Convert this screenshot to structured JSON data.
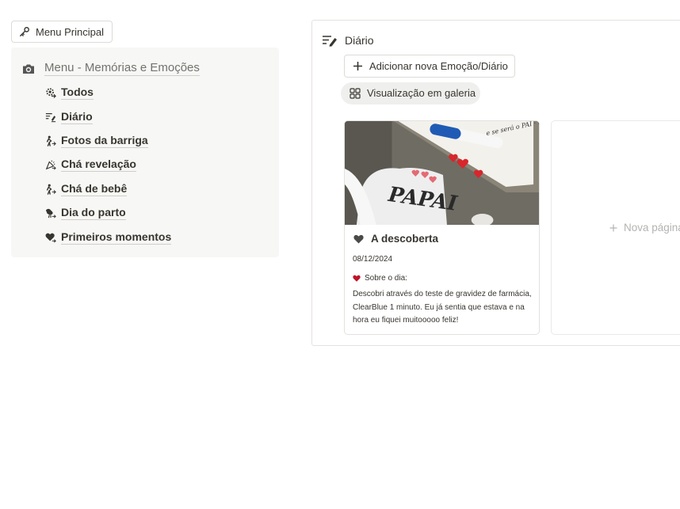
{
  "menu_principal": {
    "label": "Menu Principal",
    "icon": "key-icon"
  },
  "sidebar": {
    "header": {
      "label": "Menu - Memórias e Emoções",
      "icon": "camera-icon"
    },
    "items": [
      {
        "label": "Todos",
        "icon": "gear-heart-icon"
      },
      {
        "label": "Diário",
        "icon": "diary-list-icon"
      },
      {
        "label": "Fotos da barriga",
        "icon": "pregnant-icon"
      },
      {
        "label": "Chá revelação",
        "icon": "confetti-icon"
      },
      {
        "label": "Chá de bebê",
        "icon": "pregnant-icon"
      },
      {
        "label": "Dia do parto",
        "icon": "stork-icon"
      },
      {
        "label": "Primeiros momentos",
        "icon": "heart-icon"
      }
    ]
  },
  "diary": {
    "title": "Diário",
    "title_icon": "edit-list-icon",
    "add_button": "Adicionar nova Emoção/Diário",
    "view_tab": "Visualização em galeria",
    "cards": [
      {
        "title": "A descoberta",
        "date": "08/12/2024",
        "about_label": "Sobre o dia:",
        "description": "Descobri através do teste de gravidez de farmácia, ClearBlue 1 minuto. Eu já sentia que estava e na hora eu fiquei muitooooo feliz!",
        "cover_text": "PAPAI",
        "cover_script": "e se será o PAI · mundo!"
      }
    ],
    "new_page_label": "Nova página"
  },
  "colors": {
    "text": "#37352f",
    "muted": "#73726e",
    "sidebar_bg": "#f7f7f5",
    "border": "#e3e2e0",
    "heart_red": "#c0142a",
    "placeholder": "#b4b3b0"
  }
}
